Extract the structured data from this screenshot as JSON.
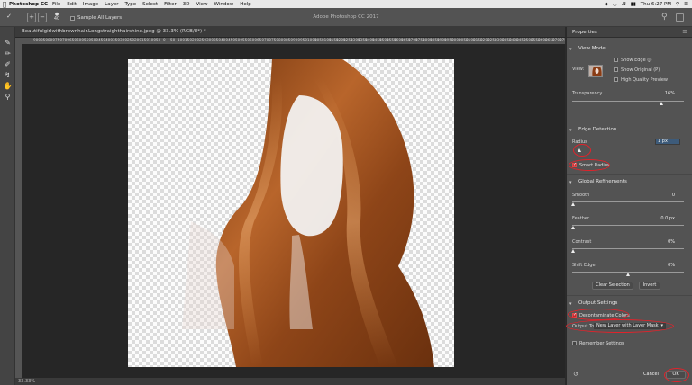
{
  "menubar": {
    "app_name": "Photoshop CC",
    "items": [
      "File",
      "Edit",
      "Image",
      "Layer",
      "Type",
      "Select",
      "Filter",
      "3D",
      "View",
      "Window",
      "Help"
    ],
    "clock": "Thu 6:27 PM"
  },
  "options_bar": {
    "window_title": "Adobe Photoshop CC 2017",
    "brush_size": "40",
    "sample_all_layers_label": "Sample All Layers"
  },
  "document": {
    "tab_label": "Beautifulgirlwithbrownhair.Longstraighthairshine.jpeg @ 33.3% (RGB/8*) *",
    "ruler_ticks": [
      "900",
      "850",
      "800",
      "750",
      "700",
      "650",
      "600",
      "550",
      "500",
      "450",
      "400",
      "350",
      "300",
      "250",
      "200",
      "150",
      "100",
      "50",
      "0",
      "50",
      "100",
      "150",
      "200",
      "250",
      "300",
      "350",
      "400",
      "450",
      "500",
      "550",
      "600",
      "650",
      "700",
      "750",
      "800",
      "850",
      "900",
      "950",
      "1000",
      "1050",
      "1100",
      "1150",
      "1200",
      "1250",
      "1300",
      "1350",
      "1400",
      "1450",
      "1500",
      "1550",
      "1600",
      "1650",
      "1700",
      "1750",
      "1800",
      "1850",
      "1900",
      "1950",
      "2000",
      "2050",
      "2100",
      "2150",
      "2200",
      "2250",
      "2300",
      "2350",
      "2400",
      "2450",
      "2500",
      "2550",
      "2600",
      "2650",
      "2700",
      "2750",
      "2800",
      "2850",
      "2900"
    ],
    "zoom_readout": "33.33%"
  },
  "properties": {
    "title": "Properties",
    "view_mode": {
      "heading": "View Mode",
      "view_label": "View:",
      "show_edge": "Show Edge (J)",
      "show_original": "Show Original (P)",
      "high_quality": "High Quality Preview",
      "transparency_label": "Transparency",
      "transparency_value": "16%",
      "transparency_level": 0.16
    },
    "edge_detection": {
      "heading": "Edge Detection",
      "radius_label": "Radius",
      "radius_value": "1 px",
      "smart_radius": "Smart Radius"
    },
    "global_refinements": {
      "heading": "Global Refinements",
      "smooth_label": "Smooth",
      "smooth_value": "0",
      "feather_label": "Feather",
      "feather_value": "0.0 px",
      "contrast_label": "Contrast",
      "contrast_value": "0%",
      "shift_edge_label": "Shift Edge",
      "shift_edge_value": "0%",
      "clear_selection": "Clear Selection",
      "invert": "Invert"
    },
    "output_settings": {
      "heading": "Output Settings",
      "decontaminate": "Decontaminate Colors",
      "output_to_label": "Output To:",
      "output_to_value": "New Layer with Layer Mask",
      "remember": "Remember Settings"
    },
    "cancel_label": "Cancel",
    "ok_label": "OK"
  },
  "colors": {
    "accent_red": "#e1232b",
    "hair_brown": "#a0501f",
    "panel_bg": "#535353"
  }
}
